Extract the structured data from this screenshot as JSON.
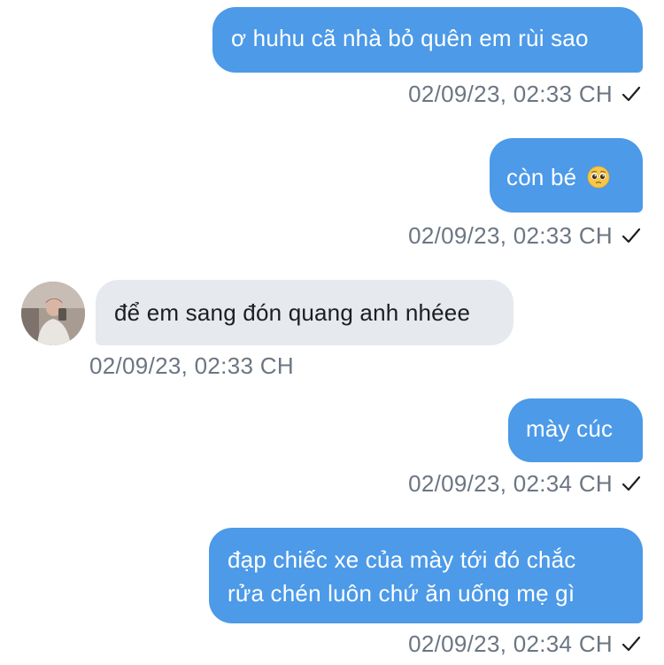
{
  "messages": [
    {
      "direction": "outgoing",
      "text": "ơ huhu cã nhà bỏ quên em rùi sao",
      "timestamp": "02/09/23, 02:33 CH",
      "status_icon": "checkmark-icon"
    },
    {
      "direction": "outgoing",
      "text": "còn bé",
      "emoji": "pleading-face-emoji",
      "timestamp": "02/09/23, 02:33 CH",
      "status_icon": "checkmark-icon"
    },
    {
      "direction": "incoming",
      "text": "để em sang đón quang anh nhéee",
      "timestamp": "02/09/23, 02:33 CH",
      "avatar": "contact-avatar"
    },
    {
      "direction": "outgoing",
      "text": "mày cúc",
      "timestamp": "02/09/23, 02:34 CH",
      "status_icon": "checkmark-icon"
    },
    {
      "direction": "outgoing",
      "lines": [
        "đạp chiếc xe của mày tới đó chắc",
        "rửa chén luôn chứ ăn uống mẹ gì"
      ],
      "timestamp": "02/09/23, 02:34 CH",
      "status_icon": "checkmark-icon"
    }
  ],
  "colors": {
    "outgoing_bubble": "#4c9ae8",
    "incoming_bubble": "#e6e9ed",
    "timestamp_text": "#6b7682"
  }
}
